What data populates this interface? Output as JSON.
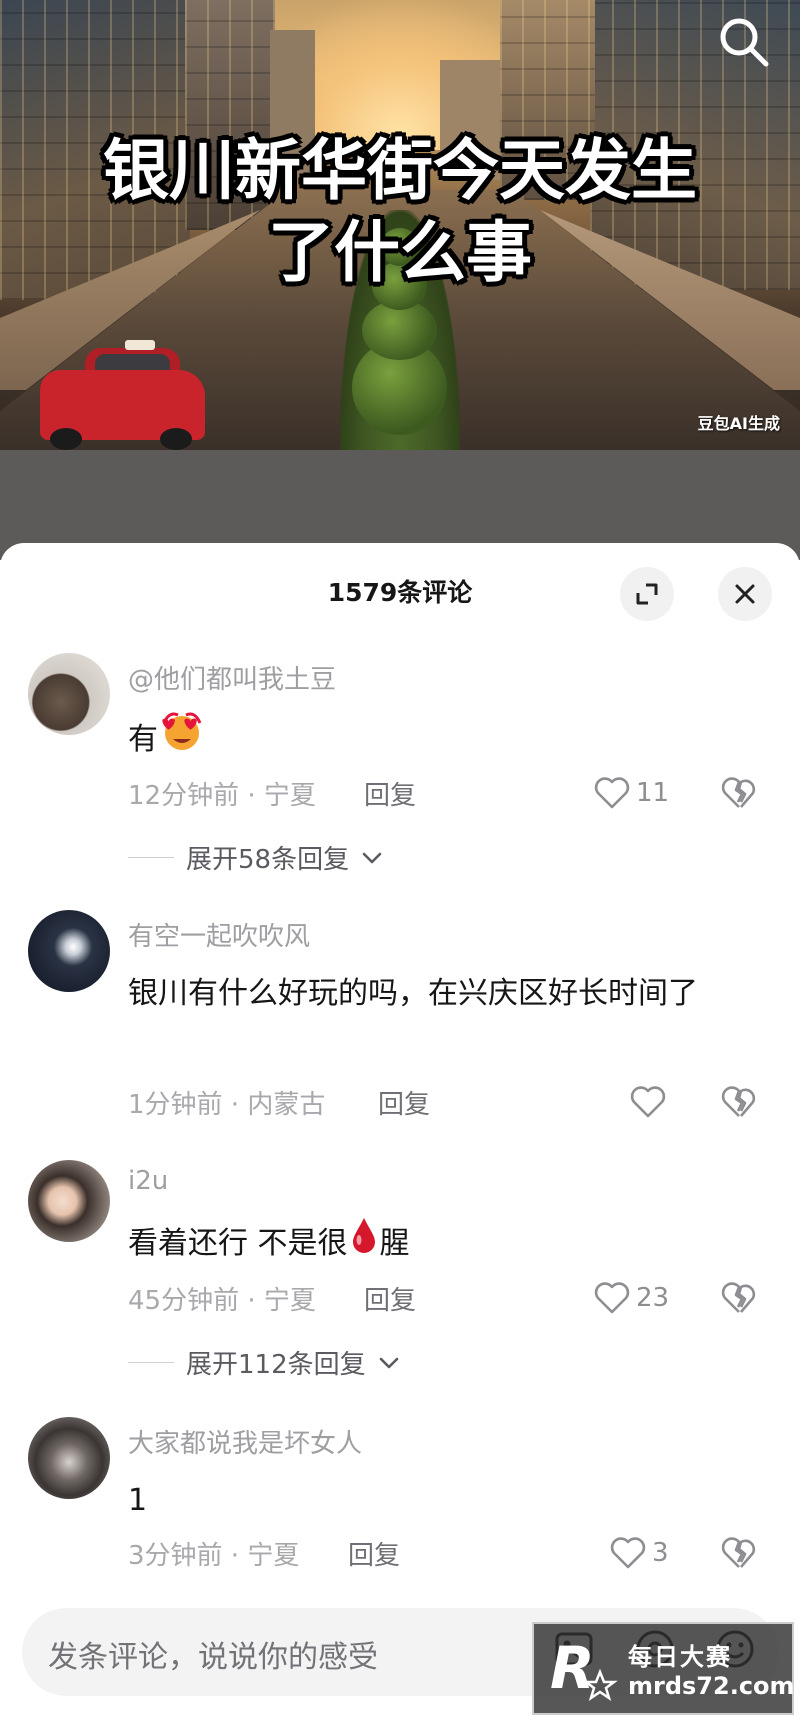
{
  "video": {
    "title_line1": "银川新华街今天发生",
    "title_line2": "了什么事",
    "ai_tag": "豆包AI生成",
    "search_icon": "search-icon"
  },
  "comments_panel": {
    "title": "1579条评论",
    "expand_icon": "collapse-arrows-icon",
    "close_icon": "close-icon"
  },
  "comments": [
    {
      "author": "@他们都叫我土豆",
      "text": "有",
      "emoji": "heart-eyes-emoji",
      "time_location": "12分钟前 · 宁夏",
      "reply_label": "回复",
      "likes": "11",
      "expand_label": "展开58条回复"
    },
    {
      "author": "有空一起吹吹风",
      "text": "银川有什么好玩的吗，在兴庆区好长时间了",
      "time_location": "1分钟前 · 内蒙古",
      "reply_label": "回复",
      "likes": ""
    },
    {
      "author": "i2u",
      "text_before": "看着还行 不是很",
      "emoji": "blood-drop-emoji",
      "text_after": "腥",
      "time_location": "45分钟前 · 宁夏",
      "reply_label": "回复",
      "likes": "23",
      "expand_label": "展开112条回复"
    },
    {
      "author": "大家都说我是坏女人",
      "text": "1",
      "time_location": "3分钟前 · 宁夏",
      "reply_label": "回复",
      "likes": "3"
    }
  ],
  "input": {
    "placeholder": "发条评论，说说你的感受",
    "icons": [
      "image-icon",
      "at-icon",
      "emoji-icon"
    ]
  },
  "watermark": {
    "line1": "每日大赛",
    "line2": "mrds72.com"
  },
  "colors": {
    "accent_red": "#c9242b",
    "secondary_text": "#a8a8ad",
    "panel_bg": "#ffffff"
  }
}
